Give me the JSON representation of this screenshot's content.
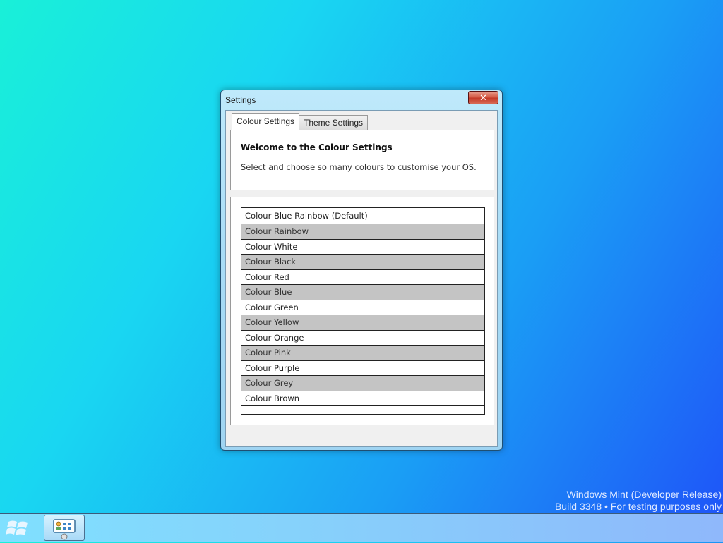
{
  "window": {
    "title": "Settings",
    "close_label": "✕"
  },
  "tabs": [
    {
      "label": "Colour Settings",
      "active": true
    },
    {
      "label": "Theme Settings",
      "active": false
    }
  ],
  "welcome": {
    "heading": "Welcome to the Colour Settings",
    "description": "Select and choose so many colours to customise your OS."
  },
  "colour_list": [
    "Colour Blue Rainbow (Default)",
    "Colour Rainbow",
    "Colour White",
    "Colour Black",
    "Colour Red",
    "Colour Blue",
    "Colour Green",
    "Colour Yellow",
    "Colour Orange",
    "Colour Pink",
    "Colour Purple",
    "Colour Grey",
    "Colour Brown"
  ],
  "watermark": {
    "line1": "Windows Mint (Developer Release)",
    "line2": "Build 3348 • For testing purposes only"
  },
  "taskbar": {
    "start_icon": "windows-logo-icon",
    "task_icon": "control-panel-icon"
  },
  "colors": {
    "list_alt_row": "#c4c4c4",
    "close_button": "#c43a28",
    "accent": "#1a9ef5"
  }
}
